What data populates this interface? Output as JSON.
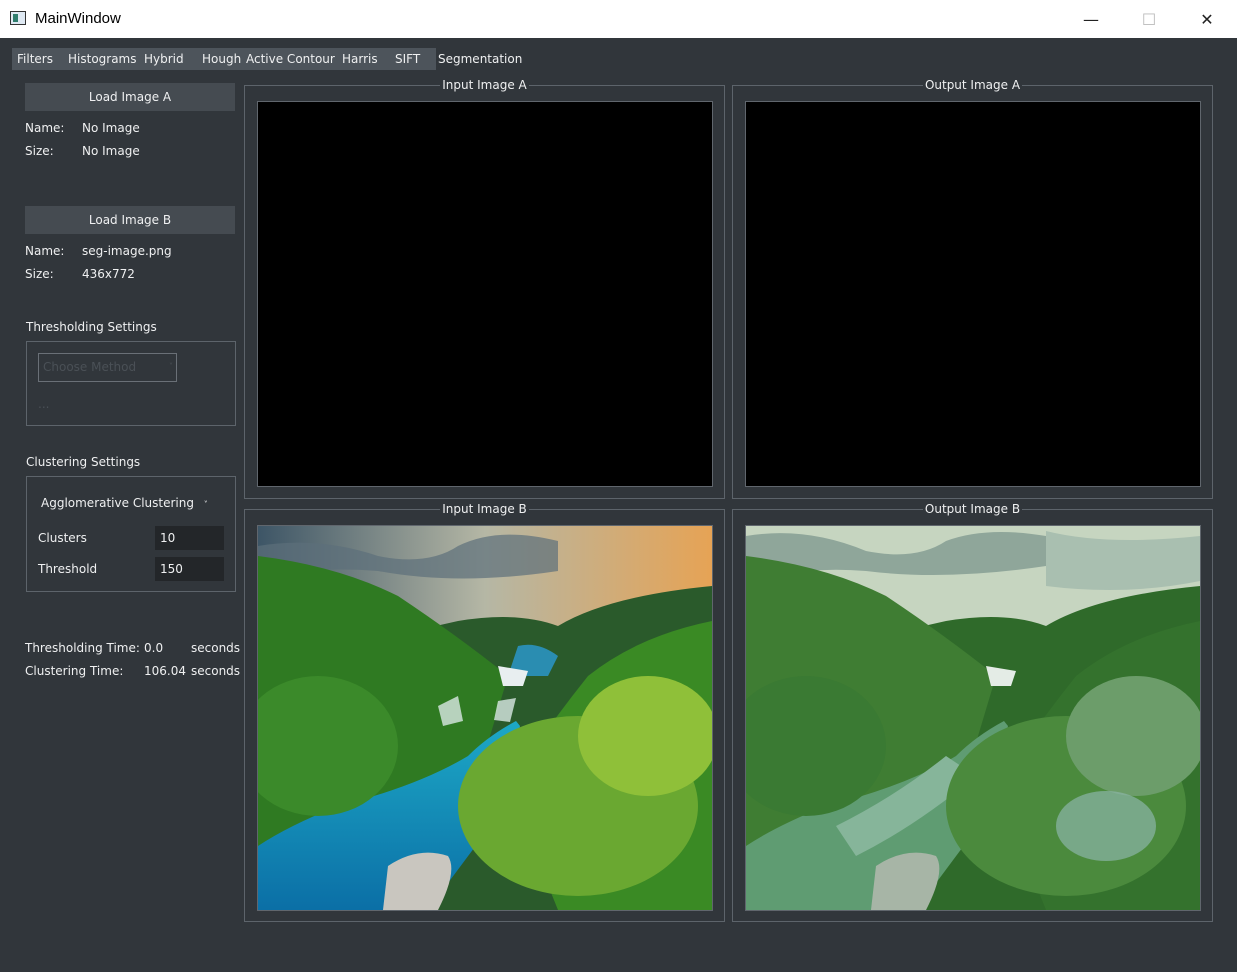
{
  "window": {
    "title": "MainWindow",
    "min_glyph": "—",
    "max_glyph": "☐",
    "close_glyph": "✕"
  },
  "tabs": [
    {
      "label": "Filters"
    },
    {
      "label": "Histograms"
    },
    {
      "label": "Hybrid"
    },
    {
      "label": "Hough"
    },
    {
      "label": "Active Contour"
    },
    {
      "label": "Harris"
    },
    {
      "label": "SIFT"
    },
    {
      "label": "Segmentation",
      "active": true
    }
  ],
  "image_a": {
    "button": "Load Image A",
    "name_label": "Name:",
    "name_value": "No Image",
    "size_label": "Size:",
    "size_value": "No Image"
  },
  "image_b": {
    "button": "Load Image B",
    "name_label": "Name:",
    "name_value": "seg-image.png",
    "size_label": "Size:",
    "size_value": "436x772"
  },
  "thresholding": {
    "title": "Thresholding Settings",
    "method_placeholder": "Choose Method",
    "extra": "..."
  },
  "clustering": {
    "title": "Clustering Settings",
    "method": "Agglomerative Clustering",
    "clusters_label": "Clusters",
    "clusters_value": "10",
    "threshold_label": "Threshold",
    "threshold_value": "150"
  },
  "timing": {
    "thresholding_label": "Thresholding Time:",
    "thresholding_value": "0.0",
    "clustering_label": "Clustering Time:",
    "clustering_value": "106.04",
    "unit": "seconds"
  },
  "viewports": {
    "input_a": "Input Image A",
    "output_a": "Output Image A",
    "input_b": "Input Image B",
    "output_b": "Output Image B"
  },
  "colors": {
    "background": "#31363b",
    "button": "#454b51",
    "tab": "#4d545b",
    "image_empty": "#000000"
  }
}
